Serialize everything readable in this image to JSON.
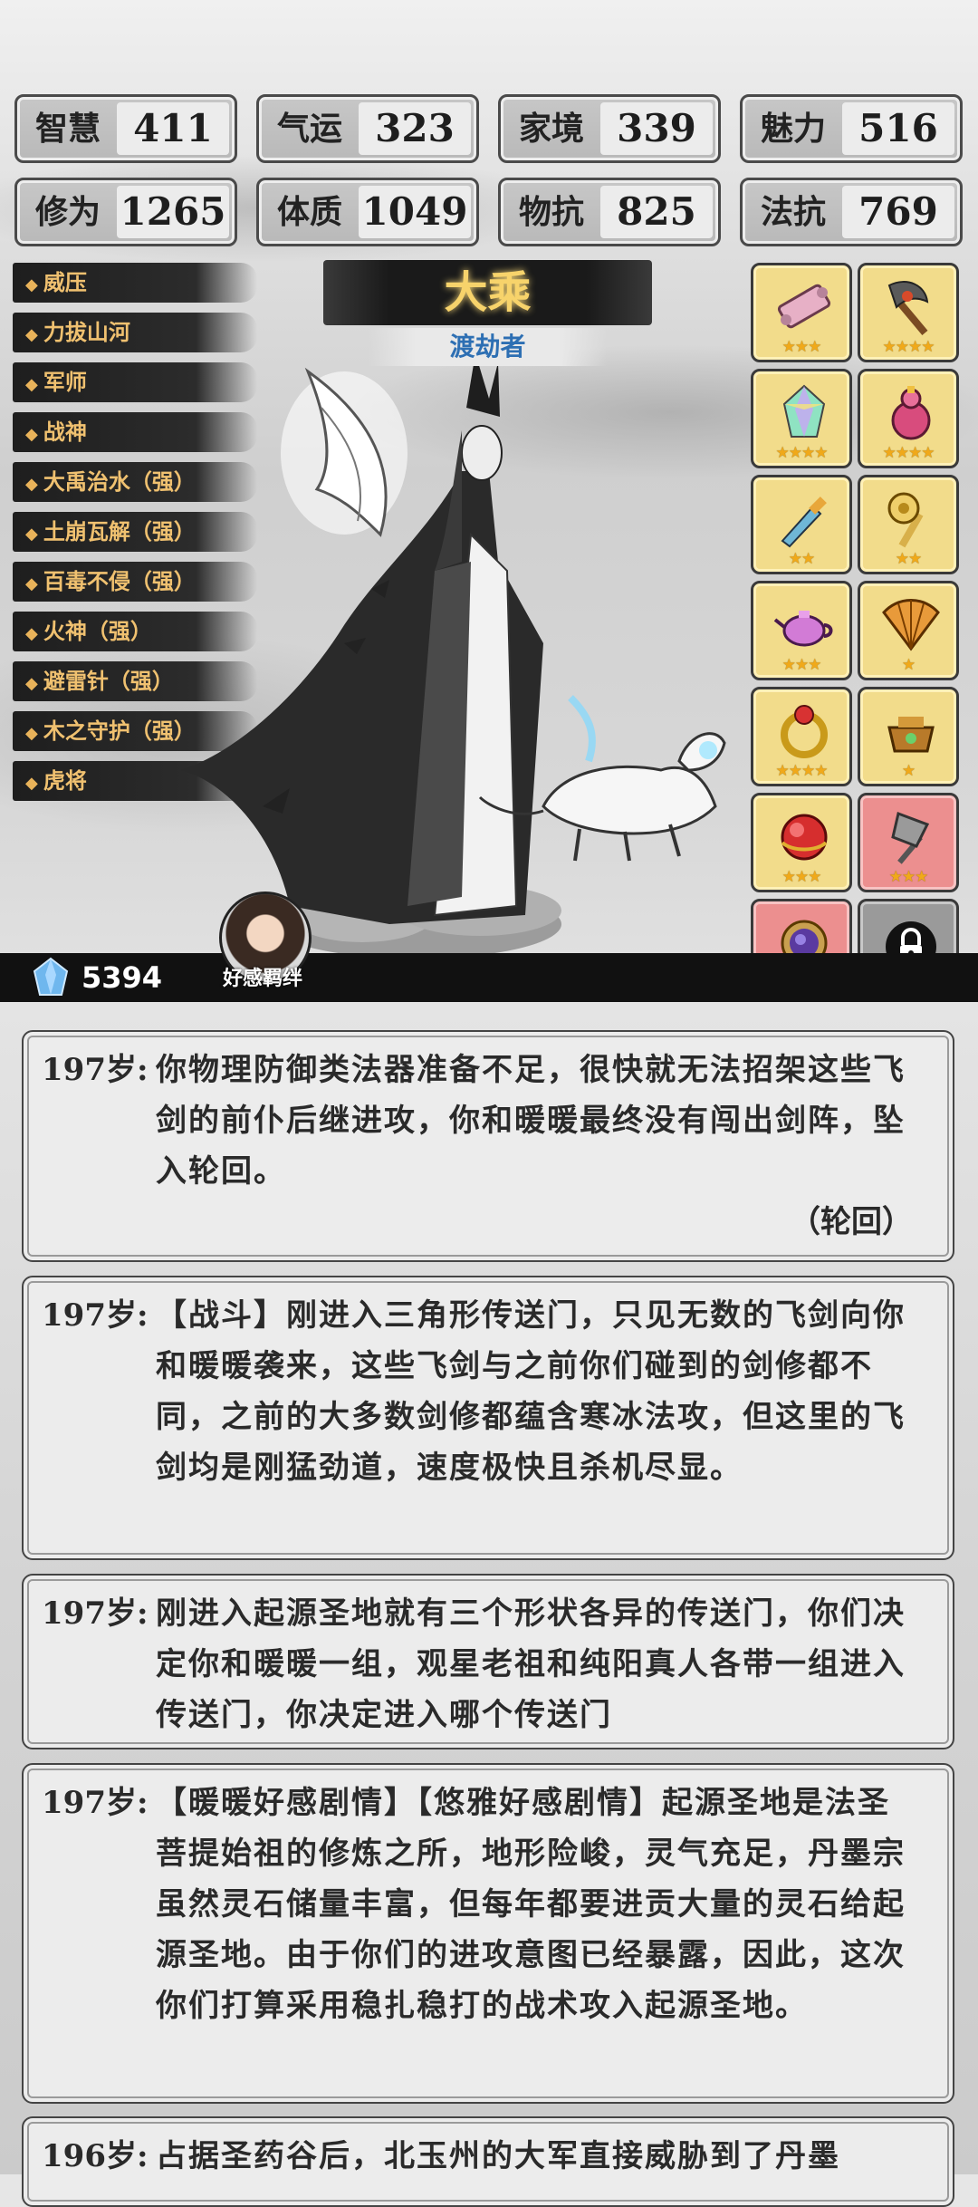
{
  "stats": [
    {
      "label": "智慧",
      "value": "411"
    },
    {
      "label": "气运",
      "value": "323"
    },
    {
      "label": "家境",
      "value": "339"
    },
    {
      "label": "魅力",
      "value": "516"
    },
    {
      "label": "修为",
      "value": "1265"
    },
    {
      "label": "体质",
      "value": "1049"
    },
    {
      "label": "物抗",
      "value": "825"
    },
    {
      "label": "法抗",
      "value": "769"
    }
  ],
  "skills": [
    "威压",
    "力拔山河",
    "军师",
    "战神",
    "大禹治水（强）",
    "土崩瓦解（强）",
    "百毒不侵（强）",
    "火神（强）",
    "避雷针（强）",
    "木之守护（强）",
    "虎将"
  ],
  "realm": {
    "title": "大乘",
    "subtitle": "渡劫者"
  },
  "items": [
    {
      "icon": "scroll-icon",
      "stars": "★★★"
    },
    {
      "icon": "axe-icon",
      "stars": "★★★★"
    },
    {
      "icon": "crystal-icon",
      "stars": "★★★★"
    },
    {
      "icon": "gourd-icon",
      "stars": "★★★★"
    },
    {
      "icon": "dagger-icon",
      "stars": "★★"
    },
    {
      "icon": "mace-icon",
      "stars": "★★"
    },
    {
      "icon": "teapot-icon",
      "stars": "★★★"
    },
    {
      "icon": "fan-icon",
      "stars": "★"
    },
    {
      "icon": "ring-icon",
      "stars": "★★★★"
    },
    {
      "icon": "cauldron-icon",
      "stars": "★"
    },
    {
      "icon": "orb-icon",
      "stars": "★★★"
    },
    {
      "icon": "spade-icon",
      "stars": "★★★"
    },
    {
      "icon": "mirror-icon",
      "stars": "★★"
    },
    {
      "icon": "lock-icon",
      "stars": ""
    }
  ],
  "currency": {
    "spirit_stones": "5394"
  },
  "affinity_label": "好感羁绊",
  "log": [
    {
      "age": "197岁:",
      "text": "你物理防御类法器准备不足，很快就无法招架这些飞剑的前仆后继进攻，你和暖暖最终没有闯出剑阵，坠入轮回。",
      "tag": "（轮回）"
    },
    {
      "age": "197岁:",
      "text": "【战斗】刚进入三角形传送门，只见无数的飞剑向你和暖暖袭来，这些飞剑与之前你们碰到的剑修都不同，之前的大多数剑修都蕴含寒冰法攻，但这里的飞剑均是刚猛劲道，速度极快且杀机尽显。",
      "tag": ""
    },
    {
      "age": "197岁:",
      "text": "刚进入起源圣地就有三个形状各异的传送门，你们决定你和暖暖一组，观星老祖和纯阳真人各带一组进入传送门，你决定进入哪个传送门",
      "tag": ""
    },
    {
      "age": "197岁:",
      "text": "【暖暖好感剧情】【悠雅好感剧情】起源圣地是法圣菩提始祖的修炼之所，地形险峻，灵气充足，丹墨宗虽然灵石储量丰富，但每年都要进贡大量的灵石给起源圣地。由于你们的进攻意图已经暴露，因此，这次你们打算采用稳扎稳打的战术攻入起源圣地。",
      "tag": ""
    },
    {
      "age": "196岁:",
      "text": "占据圣药谷后，北玉州的大军直接威胁到了丹墨",
      "tag": ""
    }
  ]
}
